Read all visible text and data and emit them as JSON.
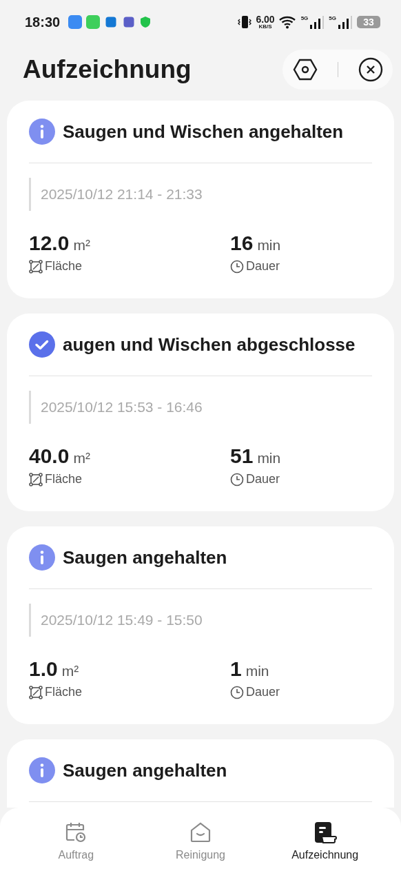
{
  "status_bar": {
    "time": "18:30",
    "speed": "6.00",
    "speed_unit": "KB/S",
    "network_1": "5G",
    "network_2": "5G",
    "battery": "33"
  },
  "header": {
    "title": "Aufzeichnung"
  },
  "records": [
    {
      "kind": "info",
      "title": "Saugen und Wischen angehalten",
      "time_range": "2025/10/12 21:14 - 21:33",
      "area": "12.0",
      "area_unit": "m²",
      "area_label": "Fläche",
      "duration": "16",
      "duration_unit": "min",
      "duration_label": "Dauer"
    },
    {
      "kind": "done",
      "title": "augen und Wischen abgeschlosse",
      "time_range": "2025/10/12 15:53 - 16:46",
      "area": "40.0",
      "area_unit": "m²",
      "area_label": "Fläche",
      "duration": "51",
      "duration_unit": "min",
      "duration_label": "Dauer"
    },
    {
      "kind": "info",
      "title": "Saugen angehalten",
      "time_range": "2025/10/12 15:49 - 15:50",
      "area": "1.0",
      "area_unit": "m²",
      "area_label": "Fläche",
      "duration": "1",
      "duration_unit": "min",
      "duration_label": "Dauer"
    },
    {
      "kind": "info",
      "title": "Saugen angehalten"
    }
  ],
  "tabs": [
    {
      "kind": "schedule",
      "label": "Auftrag",
      "selected": false
    },
    {
      "kind": "home",
      "label": "Reinigung",
      "selected": false
    },
    {
      "kind": "records",
      "label": "Aufzeichnung",
      "selected": true
    }
  ]
}
